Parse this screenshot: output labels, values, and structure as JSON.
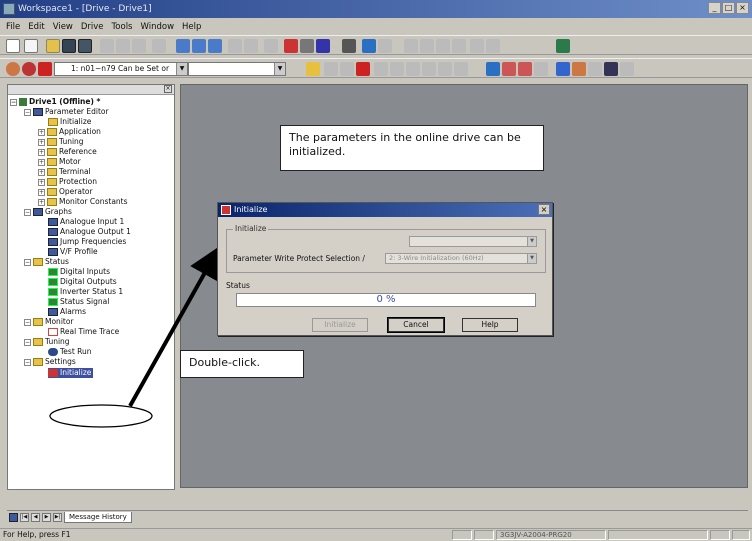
{
  "window": {
    "title": "Workspace1 - [Drive - Drive1]"
  },
  "menu": [
    "File",
    "Edit",
    "View",
    "Drive",
    "Tools",
    "Window",
    "Help"
  ],
  "toolbar": {
    "param_combo": "1: n01~n79 Can be Set or"
  },
  "tree": {
    "root": "Drive1 (Offline) *",
    "parameter_editor": "Parameter Editor",
    "pe_children": [
      "Initialize",
      "Application",
      "Tuning",
      "Reference",
      "Motor",
      "Terminal",
      "Protection",
      "Operator",
      "Monitor Constants"
    ],
    "graphs": "Graphs",
    "graph_children": [
      "Analogue Input 1",
      "Analogue Output 1",
      "Jump Frequencies",
      "V/F Profile"
    ],
    "status": "Status",
    "status_children": [
      "Digital Inputs",
      "Digital Outputs",
      "Inverter Status 1",
      "Status Signal",
      "Alarms"
    ],
    "monitor": "Monitor",
    "monitor_children": [
      "Real Time Trace"
    ],
    "tuning": "Tuning",
    "tuning_children": [
      "Test Run"
    ],
    "settings": "Settings",
    "settings_children": [
      "Initialize"
    ]
  },
  "callouts": {
    "top": "The parameters in the online drive can be initialized.",
    "bottom": "Double-click."
  },
  "dialog": {
    "title": "Initialize",
    "group_label": "Initialize",
    "param_label": "Parameter Write Protect Selection /",
    "param_value": "2: 3-Wire Initialization (60Hz)",
    "status_label": "Status",
    "progress_text": "0 %",
    "progress": 0,
    "buttons": {
      "initialize": "Initialize",
      "cancel": "Cancel",
      "help": "Help"
    }
  },
  "bottom_tabs": {
    "message_history": "Message History"
  },
  "statusbar": {
    "help": "For Help, press F1",
    "model": "3G3JV-A2004-PRG20"
  }
}
